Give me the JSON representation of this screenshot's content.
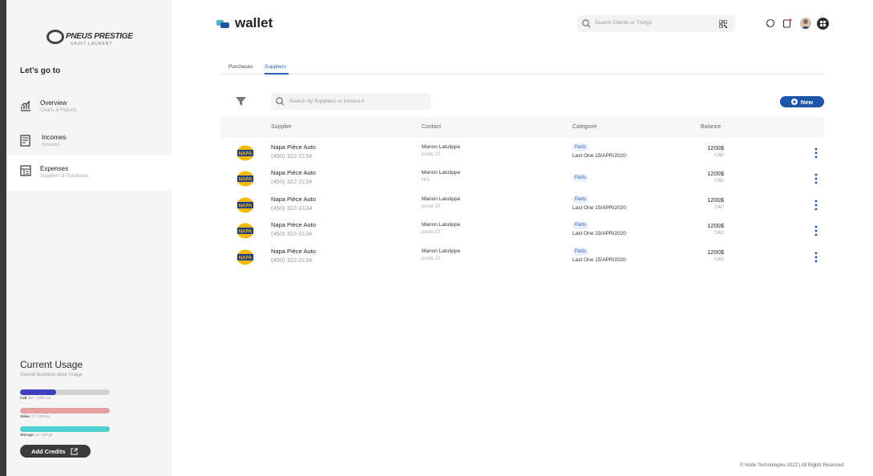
{
  "sidebar": {
    "brand_name": "PNEUS PRESTIGE",
    "brand_sub": "SAINT-LAURENT",
    "section_title": "Let’s go to",
    "items": [
      {
        "title": "Overview",
        "sub": "Charts & Reports",
        "icon": "chart-icon"
      },
      {
        "title": "Incomes",
        "sub": "Invoices",
        "icon": "invoice-icon"
      },
      {
        "title": "Expenses",
        "sub": "Suppliers & Purchases",
        "icon": "receipt-icon"
      }
    ],
    "usage": {
      "title": "Current Usage",
      "sub": "Overall business desk Usage",
      "bars": [
        {
          "name": "Call",
          "detail": "357 / 1000 mn",
          "fraction": 0.4,
          "color": "#3f3fc0"
        },
        {
          "name": "Video",
          "detail": "72 / 100 mn",
          "fraction": 1.0,
          "color": "#e8a0a0"
        },
        {
          "name": "Storage",
          "detail": "12 / 100 go",
          "fraction": 1.0,
          "color": "#4fd0d0"
        }
      ]
    },
    "add_credits": "Add Credits"
  },
  "header": {
    "title": "wallet",
    "search_placeholder": "Search Clients or Things"
  },
  "tabs": [
    {
      "label": "Purchases"
    },
    {
      "label": "Suppliers"
    }
  ],
  "toolbar": {
    "search_placeholder": "Search by Suppliers or Invoice #",
    "new_label": "New"
  },
  "table": {
    "headers": {
      "supplier": "Supplier",
      "contact": "Contact",
      "category": "Categorie",
      "balance": "Balance"
    },
    "rows": [
      {
        "logo": "NAPA",
        "name": "Napa Pièce Auto",
        "phone": "(450) 322-2134",
        "contact": "Manon Latulippe",
        "contact_sub": "poste 23",
        "category": "Parts",
        "last": "Last One 15/APR/2020",
        "balance": "1200$",
        "currency": "CAD"
      },
      {
        "logo": "NAPA",
        "name": "Napa Pièce Auto",
        "phone": "(450) 322-2134",
        "contact": "Manon Latulippe",
        "contact_sub": "N/A",
        "category": "Parts",
        "last": "",
        "balance": "1200$",
        "currency": "CAD"
      },
      {
        "logo": "NAPA",
        "name": "Napa Pièce Auto",
        "phone": "(450) 322-2134",
        "contact": "Manon Latulippe",
        "contact_sub": "poste 23",
        "category": "Parts",
        "last": "Last One 15/APR/2020",
        "balance": "1200$",
        "currency": "CAD"
      },
      {
        "logo": "NAPA",
        "name": "Napa Pièce Auto",
        "phone": "(450) 322-2134",
        "contact": "Manon Latulippe",
        "contact_sub": "poste 23",
        "category": "Parts",
        "last": "Last One 15/APR/2020",
        "balance": "1200$",
        "currency": "CAD"
      },
      {
        "logo": "NAPA",
        "name": "Napa Pièce Auto",
        "phone": "(450) 322-2134",
        "contact": "Manon Latulippe",
        "contact_sub": "poste 23",
        "category": "Parts",
        "last": "Last One 15/APR/2020",
        "balance": "1200$",
        "currency": "CAD"
      }
    ]
  },
  "footer": "© Node Technologies 2022 | All Rights Reserved",
  "colors": {
    "accent": "#1d55a8",
    "tab_active": "#2e5fb0",
    "sidebar_bg": "#f5f5f6"
  }
}
